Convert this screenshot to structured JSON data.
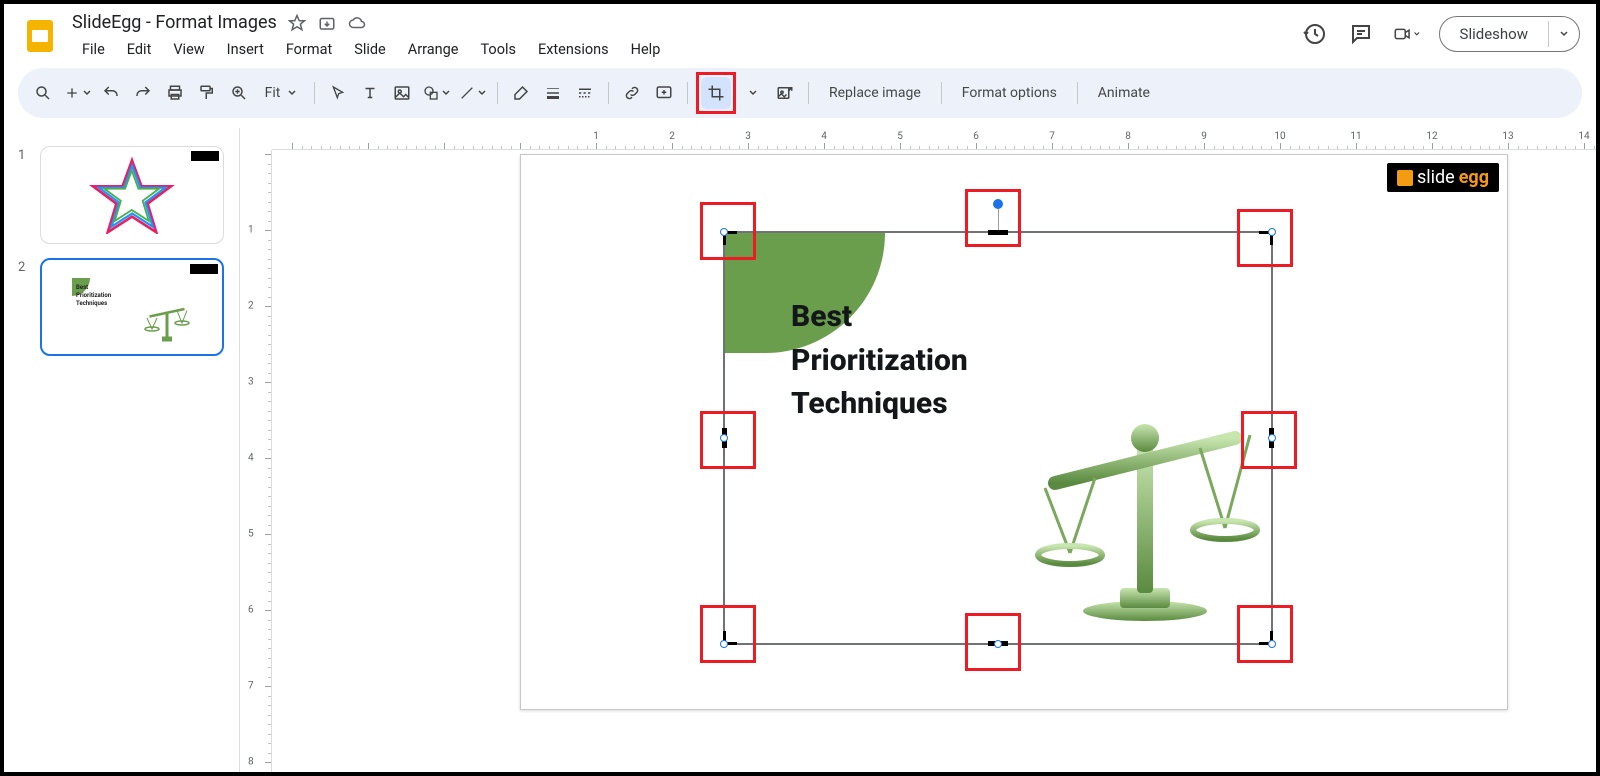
{
  "doc": {
    "title": "SlideEgg - Format Images"
  },
  "menu": [
    "File",
    "Edit",
    "View",
    "Insert",
    "Format",
    "Slide",
    "Arrange",
    "Tools",
    "Extensions",
    "Help"
  ],
  "right": {
    "slideshow": "Slideshow"
  },
  "toolbar": {
    "zoom": "Fit",
    "replace_image": "Replace image",
    "format_options": "Format options",
    "animate": "Animate"
  },
  "thumbs": [
    {
      "num": "1",
      "selected": false
    },
    {
      "num": "2",
      "selected": true
    }
  ],
  "slide": {
    "logo_text_a": "slide",
    "logo_text_b": "egg",
    "heading_lines": [
      "Best",
      "Prioritization",
      "Techniques"
    ]
  }
}
